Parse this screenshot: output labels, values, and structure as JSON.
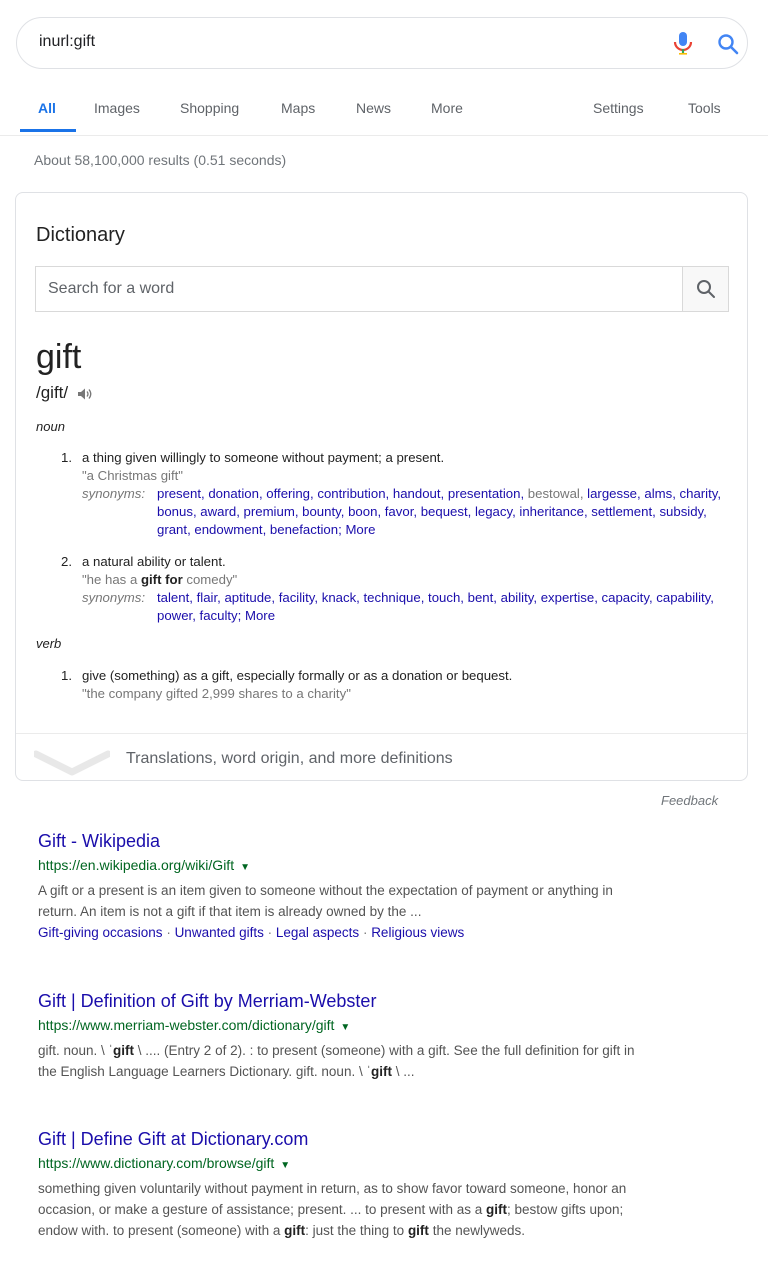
{
  "search": {
    "query": "inurl:gift"
  },
  "tabs": [
    "All",
    "Images",
    "Shopping",
    "Maps",
    "News",
    "More",
    "Settings",
    "Tools"
  ],
  "result_stats": "About 58,100,000 results (0.51 seconds)",
  "dictionary": {
    "title": "Dictionary",
    "input_placeholder": "Search for a word",
    "word": "gift",
    "phonetic": "/gift/",
    "noun_label": "noun",
    "verb_label": "verb",
    "synonyms_label": "synonyms:",
    "more_label": "More",
    "noun_senses": [
      {
        "num": "1.",
        "definition": "a thing given willingly to someone without payment; a present.",
        "example": "\"a Christmas gift\"",
        "synonyms": [
          "present",
          "donation",
          "offering",
          "contribution",
          "handout",
          "presentation",
          "bestowal",
          "largesse",
          "alms",
          "charity",
          "bonus",
          "award",
          "premium",
          "bounty",
          "boon",
          "favor",
          "bequest",
          "legacy",
          "inheritance",
          "settlement",
          "subsidy",
          "grant",
          "endowment",
          "benefaction"
        ]
      },
      {
        "num": "2.",
        "definition": "a natural ability or talent.",
        "example_pre": "\"he has a ",
        "example_bold": "gift for",
        "example_post": " comedy\"",
        "synonyms": [
          "talent",
          "flair",
          "aptitude",
          "facility",
          "knack",
          "technique",
          "touch",
          "bent",
          "ability",
          "expertise",
          "capacity",
          "capability",
          "power",
          "faculty"
        ]
      }
    ],
    "verb_senses": [
      {
        "num": "1.",
        "definition": "give (something) as a gift, especially formally or as a donation or bequest.",
        "example": "\"the company gifted 2,999 shares to a charity\""
      }
    ],
    "expand_text": "Translations, word origin, and more definitions"
  },
  "feedback": "Feedback",
  "results": [
    {
      "title": "Gift - Wikipedia",
      "url": "https://en.wikipedia.org/wiki/Gift",
      "snippet_1": "A gift or a present is an item given to someone without the expectation of payment or anything in",
      "snippet_2": "return. An item is not a gift if that item is already owned by the ...",
      "sitelinks": [
        "Gift-giving occasions",
        "Unwanted gifts",
        "Legal aspects",
        "Religious views"
      ]
    },
    {
      "title": "Gift | Definition of Gift by Merriam-Webster",
      "url": "https://www.merriam-webster.com/dictionary/gift",
      "s1a": "gift. noun. \\ ˈ",
      "s1b": "gift",
      "s1c": " \\ .... (Entry 2 of 2). : to present (someone) with a gift. See the full definition for gift in",
      "s2a": "the English Language Learners Dictionary. gift. noun. \\ ˈ",
      "s2b": "gift",
      "s2c": " \\ ..."
    },
    {
      "title": "Gift | Define Gift at Dictionary.com",
      "url": "https://www.dictionary.com/browse/gift",
      "l1": "something given voluntarily without payment in return, as to show favor toward someone, honor an",
      "l2a": "occasion, or make a gesture of assistance; present. ... to present with as a ",
      "l2b": "gift",
      "l2c": "; bestow gifts upon;",
      "l3a": "endow with. to present (someone) with a ",
      "l3b": "gift",
      "l3c": ": just the thing to ",
      "l3d": "gift",
      "l3e": " the newlyweds."
    }
  ]
}
